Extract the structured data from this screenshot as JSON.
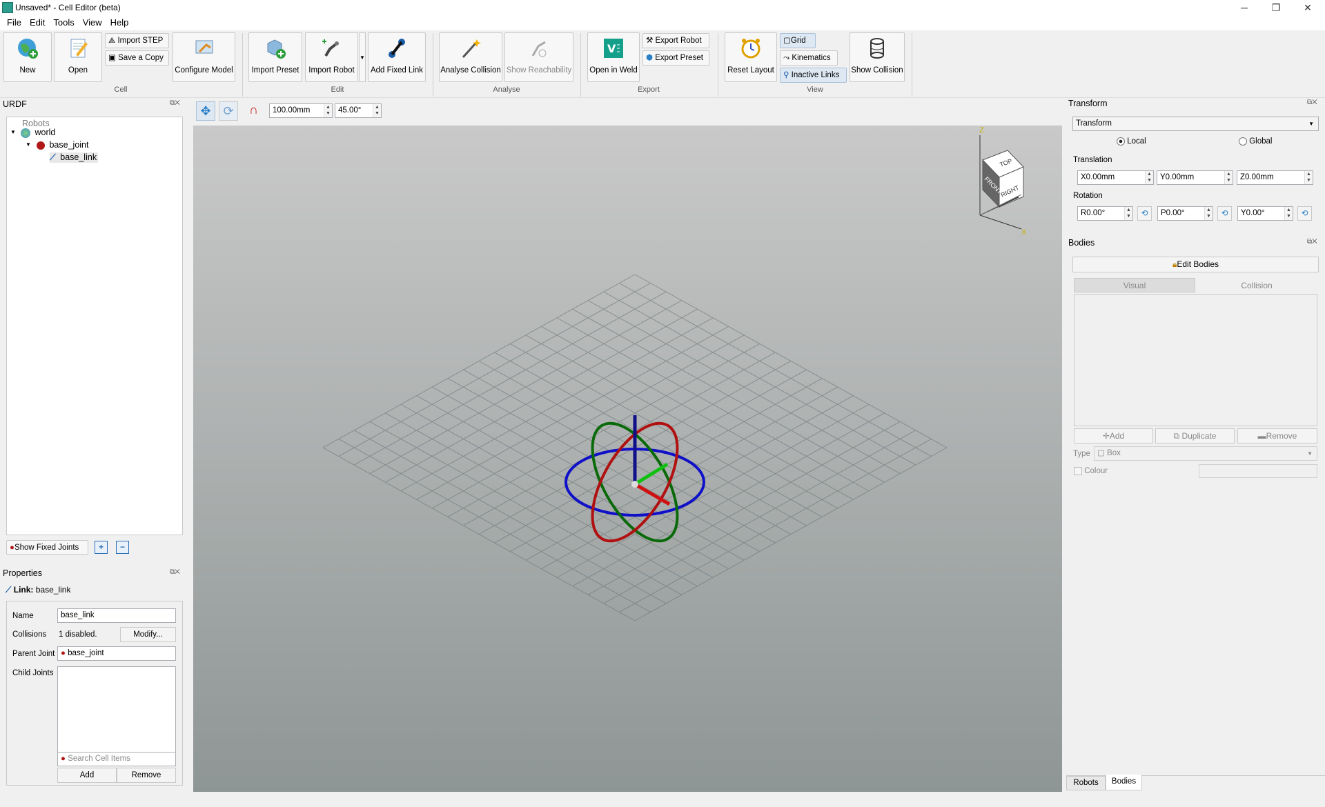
{
  "window": {
    "title": "Unsaved* - Cell Editor (beta)",
    "controls": [
      "─",
      "❐",
      "✕"
    ]
  },
  "menu": [
    "File",
    "Edit",
    "Tools",
    "View",
    "Help"
  ],
  "ribbon": {
    "cell": {
      "new": "New",
      "open": "Open",
      "import_step": "Import STEP",
      "save_copy": "Save a Copy",
      "configure": "Configure Model",
      "group": "Cell"
    },
    "edit": {
      "import_preset": "Import Preset",
      "import_robot": "Import Robot",
      "add_fixed_link": "Add Fixed Link",
      "group": "Edit"
    },
    "analyse": {
      "analyse_collision": "Analyse Collision",
      "show_reachability": "Show Reachability",
      "group": "Analyse"
    },
    "export": {
      "open_weld": "Open in Weld",
      "export_robot": "Export Robot",
      "export_preset": "Export Preset",
      "group": "Export"
    },
    "view": {
      "reset_layout": "Reset Layout",
      "grid": "Grid",
      "kinematics": "Kinematics",
      "inactive_links": "Inactive Links",
      "show_collision": "Show Collision",
      "group": "View"
    }
  },
  "urdf": {
    "title": "URDF",
    "tree": [
      {
        "label": "Robots",
        "level": 0
      },
      {
        "label": "world",
        "level": 0
      },
      {
        "label": "base_joint",
        "level": 1
      },
      {
        "label": "base_link",
        "level": 2
      }
    ],
    "show_fixed_joints": "Show Fixed Joints"
  },
  "properties": {
    "title": "Properties",
    "link_label": "Link:",
    "link_name": "base_link",
    "name_label": "Name",
    "name_value": "base_link",
    "collisions_label": "Collisions",
    "collisions_value": "1 disabled.",
    "modify": "Modify...",
    "parent_label": "Parent Joint",
    "parent_value": "base_joint",
    "child_label": "Child Joints",
    "search_placeholder": "Search Cell Items",
    "add": "Add",
    "remove": "Remove"
  },
  "viewport_toolbar": {
    "step": "100.00mm",
    "angle": "45.00°"
  },
  "viewcube": {
    "top": "TOP",
    "front": "FRONT",
    "right": "RIGHT",
    "z": "Z",
    "x": "X"
  },
  "transform": {
    "title": "Transform",
    "dropdown": "Transform",
    "local": "Local",
    "global": "Global",
    "translation": "Translation",
    "tx": "X0.00mm",
    "ty": "Y0.00mm",
    "tz": "Z0.00mm",
    "rotation": "Rotation",
    "rr": "R0.00°",
    "rp": "P0.00°",
    "ry": "Y0.00°"
  },
  "bodies": {
    "title": "Bodies",
    "edit": "Edit Bodies",
    "visual": "Visual",
    "collision": "Collision",
    "add": "Add",
    "duplicate": "Duplicate",
    "remove": "Remove",
    "type_label": "Type",
    "type_value": "Box",
    "colour": "Colour"
  },
  "bottom_tabs": [
    "Robots",
    "Bodies"
  ],
  "colors": {
    "x_axis": "#d01010",
    "y_axis": "#10c010",
    "z_axis": "#10108a",
    "ring_red": "#b01010",
    "ring_green": "#0a6a0a",
    "ring_blue": "#1010c8"
  }
}
